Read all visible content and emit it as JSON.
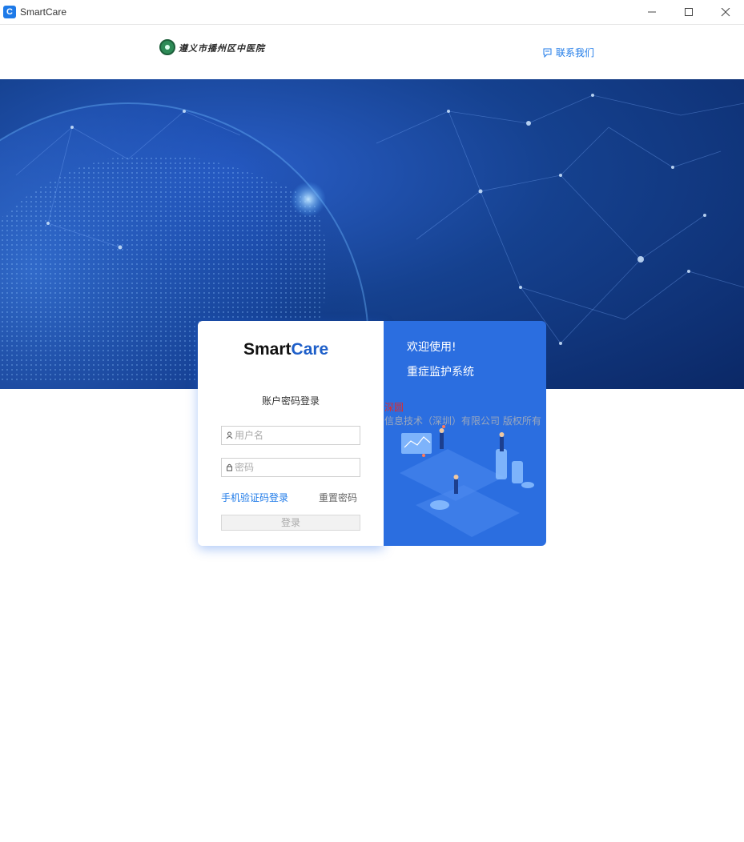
{
  "window": {
    "icon_letter": "C",
    "title": "SmartCare"
  },
  "header": {
    "hospital_name": "遵义市播州区中医院",
    "contact_label": "联系我们"
  },
  "login": {
    "brand_prefix": "Smart",
    "brand_suffix": "Care",
    "title": "账户密码登录",
    "username_placeholder": "用户名",
    "password_placeholder": "密码",
    "sms_login_label": "手机验证码登录",
    "reset_password_label": "重置密码",
    "submit_label": "登录"
  },
  "promo": {
    "welcome": "欢迎使用!",
    "system_name": "重症监护系统"
  },
  "overlay": {
    "red_text": "深圆",
    "copyright": "信息技术（深圳）有限公司 版权所有"
  },
  "colors": {
    "accent": "#1e7ae8",
    "promo_bg": "#2b6ee0",
    "hero_dark": "#0b2866"
  }
}
